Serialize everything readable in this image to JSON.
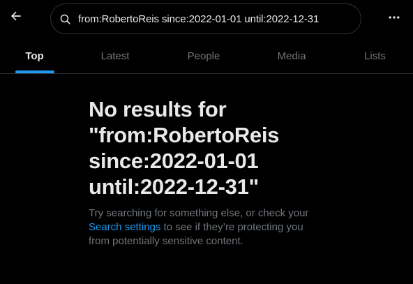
{
  "search": {
    "query": "from:RobertoReis since:2022-01-01 until:2022-12-31"
  },
  "tabs": [
    {
      "label": "Top",
      "active": true
    },
    {
      "label": "Latest",
      "active": false
    },
    {
      "label": "People",
      "active": false
    },
    {
      "label": "Media",
      "active": false
    },
    {
      "label": "Lists",
      "active": false
    }
  ],
  "empty_state": {
    "title_line1": "No results for",
    "title_line2": "\"from:RobertoReis",
    "title_line3": "since:2022-01-01",
    "title_line4": "until:2022-12-31\"",
    "body_line1": "Try searching for something else, or check your",
    "link_text": "Search settings",
    "body_after_link": " to see if they’re protecting you",
    "body_line3": "from potentially sensitive content."
  },
  "icons": {
    "back": "arrow-left-icon",
    "search": "search-icon",
    "more": "more-icon"
  },
  "colors": {
    "background": "#000000",
    "accent": "#1d9bf0",
    "text_primary": "#e7e9ea",
    "text_secondary": "#71767b",
    "border": "#2f3336"
  }
}
